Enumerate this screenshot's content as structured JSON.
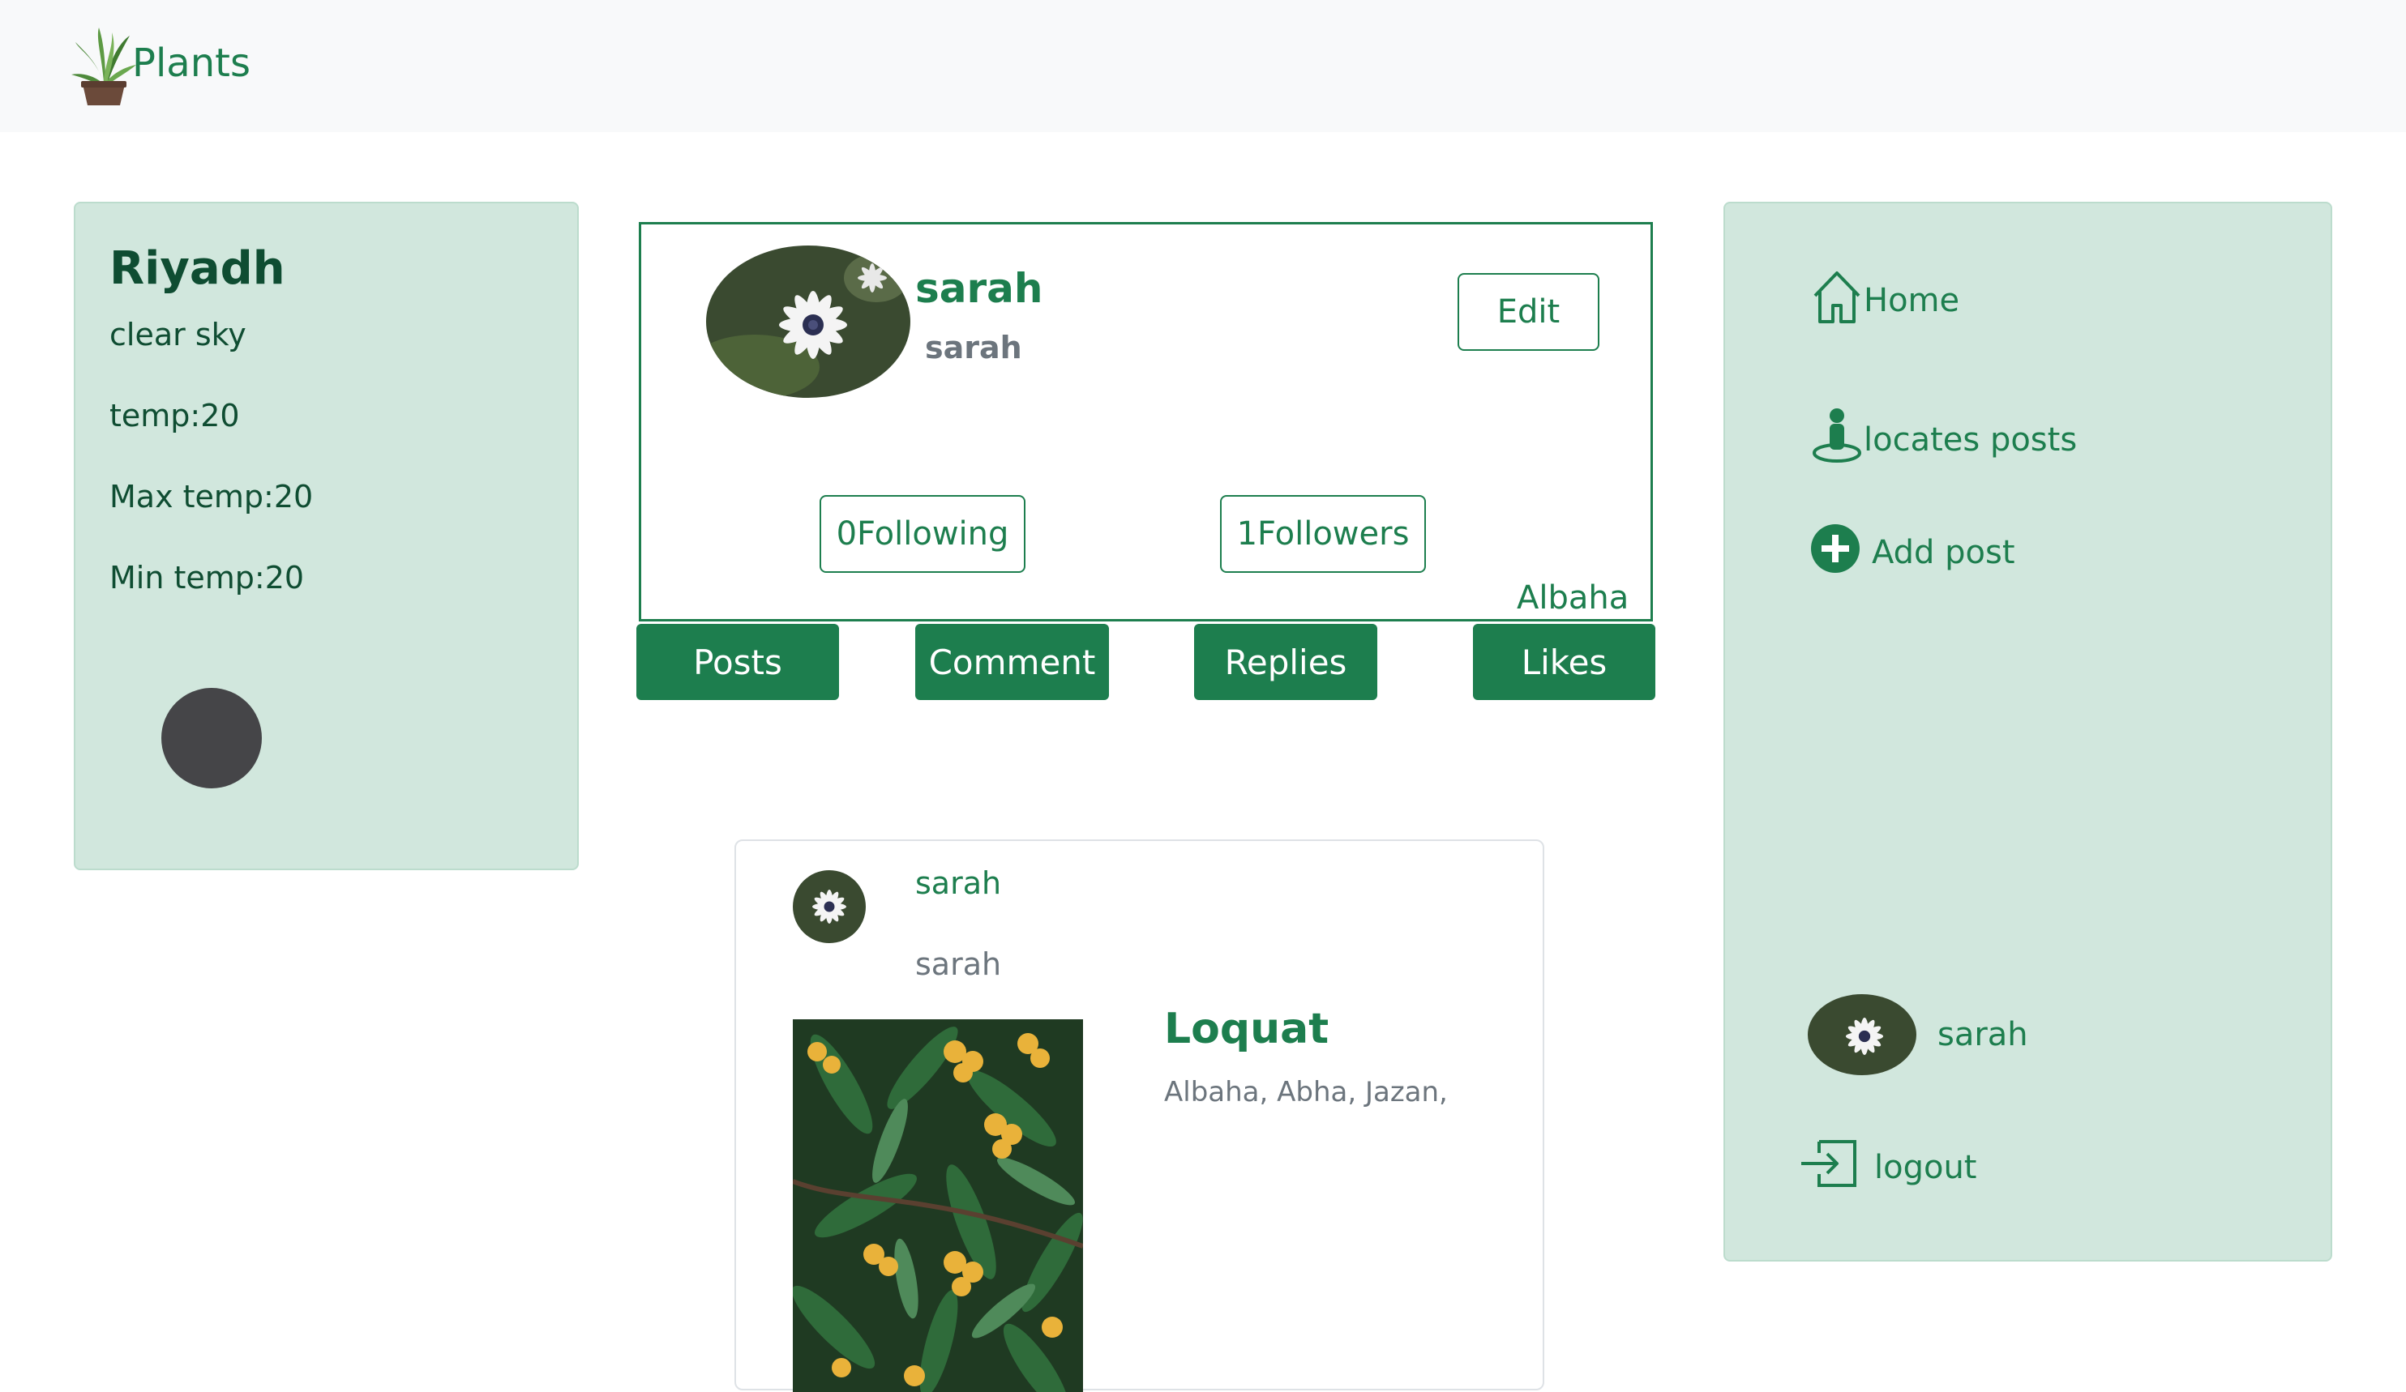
{
  "navbar": {
    "brand": "Plants",
    "logo_icon": "potted-plant-icon"
  },
  "weather": {
    "city": "Riyadh",
    "description": "clear sky",
    "temp": "temp:20",
    "max_temp": "Max temp:20",
    "min_temp": "Min temp:20"
  },
  "profile": {
    "name": "sarah",
    "username": "sarah",
    "edit_label": "Edit",
    "following_label": "0Following",
    "followers_label": "1Followers",
    "location": "Albaha"
  },
  "tabs": [
    "Posts",
    "Comment",
    "Replies",
    "Likes"
  ],
  "post": {
    "author_name": "sarah",
    "author_username": "sarah",
    "title": "Loquat",
    "locations": "Albaha, Abha, Jazan,"
  },
  "sidebar": {
    "items": [
      {
        "label": "Home",
        "icon": "house-icon"
      },
      {
        "label": "locates posts",
        "icon": "person-location-icon"
      },
      {
        "label": "Add post",
        "icon": "plus-circle-icon"
      }
    ],
    "user_name": "sarah",
    "logout_label": "logout"
  },
  "colors": {
    "accent": "#1d7e4e",
    "card_bg": "#d1e7dd",
    "navbar_bg": "#f8f9fa"
  }
}
